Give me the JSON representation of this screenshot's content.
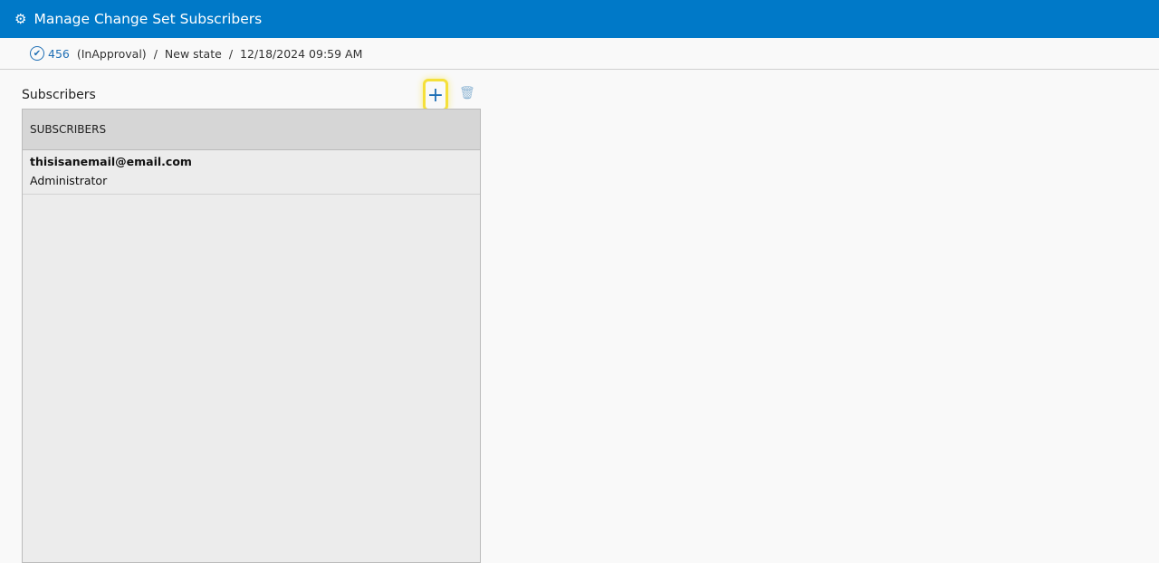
{
  "header": {
    "title": "Manage Change Set Subscribers",
    "icon": "gears-icon"
  },
  "breadcrumb": {
    "id": "456",
    "status": "(InApproval)",
    "sep": "/",
    "state": "New state",
    "date": "12/18/2024 09:59 AM"
  },
  "panel": {
    "title": "Subscribers",
    "add": "+",
    "column": "SUBSCRIBERS",
    "rows": [
      {
        "email": "thisisanemail@email.com",
        "role": "Administrator"
      }
    ]
  }
}
